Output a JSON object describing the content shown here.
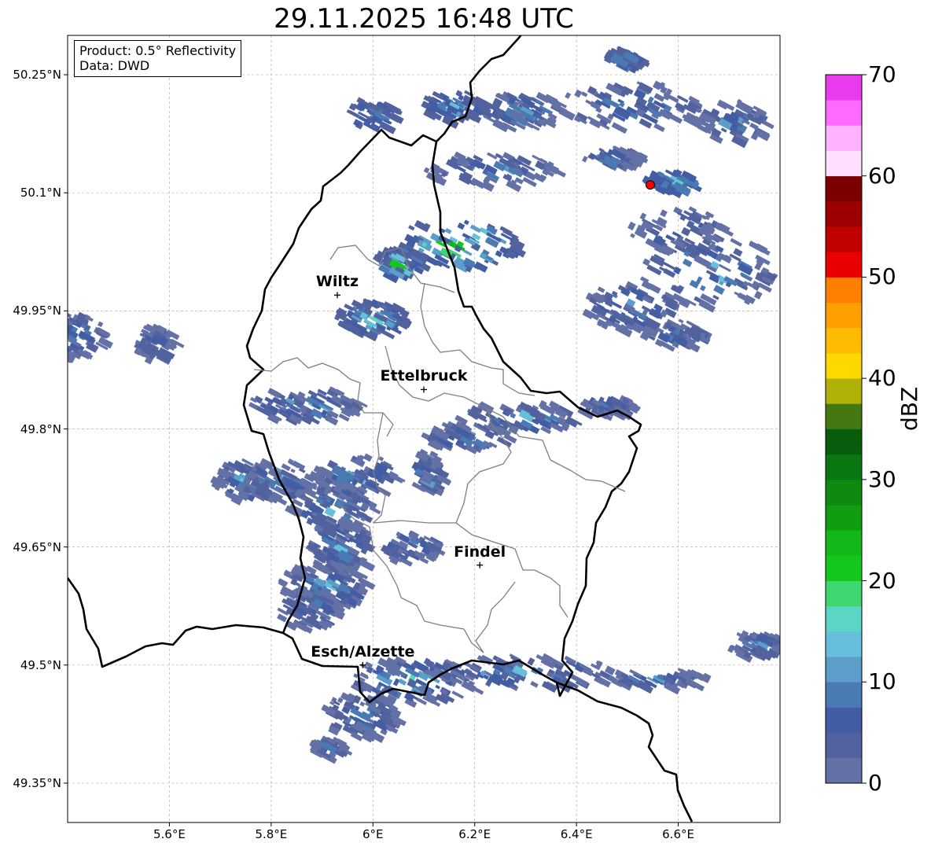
{
  "title": "29.11.2025 16:48 UTC",
  "info": {
    "product": "Product: 0.5° Reflectivity",
    "data": "Data: DWD"
  },
  "lat_ticks": [
    "50.25°N",
    "50.1°N",
    "49.95°N",
    "49.8°N",
    "49.65°N",
    "49.5°N",
    "49.35°N"
  ],
  "lon_ticks": [
    "5.6°E",
    "5.8°E",
    "6°E",
    "6.2°E",
    "6.4°E",
    "6.6°E"
  ],
  "cities": [
    {
      "name": "Wiltz",
      "lon": 5.93,
      "lat": 49.97
    },
    {
      "name": "Ettelbruck",
      "lon": 6.1,
      "lat": 49.85
    },
    {
      "name": "Findel",
      "lon": 6.21,
      "lat": 49.627
    },
    {
      "name": "Esch/Alzette",
      "lon": 5.98,
      "lat": 49.5
    }
  ],
  "radar_site": {
    "lon": 6.545,
    "lat": 50.11,
    "color": "#ff0000"
  },
  "colorbar": {
    "label": "dBZ",
    "ticks": [
      "0",
      "10",
      "20",
      "30",
      "40",
      "50",
      "60",
      "70"
    ],
    "colors": [
      "#6371a6",
      "#51629e",
      "#435da4",
      "#4a7ab3",
      "#5a9ec9",
      "#66c0dc",
      "#5cd6c4",
      "#3dd670",
      "#12c81c",
      "#12b818",
      "#109d10",
      "#0e8a10",
      "#0b7713",
      "#075d0c",
      "#457810",
      "#b0b208",
      "#ffd800",
      "#ffbb00",
      "#ff9f00",
      "#ff7f00",
      "#e80000",
      "#c10000",
      "#9c0000",
      "#7b0000",
      "#ffdeff",
      "#ffb2ff",
      "#ff6afe",
      "#ea3aee"
    ]
  },
  "extent": {
    "lon": [
      5.4,
      6.8
    ],
    "lat": [
      49.3,
      50.3
    ]
  }
}
